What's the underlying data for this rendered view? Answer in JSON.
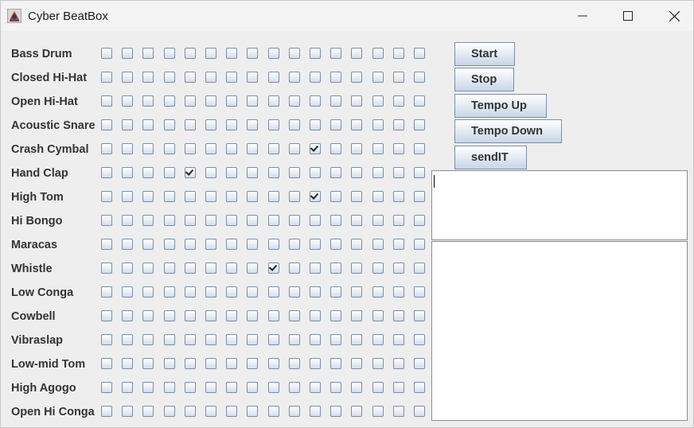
{
  "window": {
    "title": "Cyber BeatBox",
    "controls": [
      "minimize-icon",
      "maximize-icon",
      "close-icon"
    ]
  },
  "instruments": [
    "Bass Drum",
    "Closed Hi-Hat",
    "Open Hi-Hat",
    "Acoustic Snare",
    "Crash Cymbal",
    "Hand Clap",
    "High Tom",
    "Hi Bongo",
    "Maracas",
    "Whistle",
    "Low Conga",
    "Cowbell",
    "Vibraslap",
    "Low-mid Tom",
    "High Agogo",
    "Open Hi Conga"
  ],
  "steps": 16,
  "checked": [
    [
      4,
      10
    ],
    [
      5,
      4
    ],
    [
      6,
      10
    ],
    [
      9,
      8
    ]
  ],
  "buttons": {
    "start": "Start",
    "stop": "Stop",
    "tempo_up": "Tempo Up",
    "tempo_down": "Tempo Down",
    "send": "sendIT"
  },
  "message_input": {
    "value": ""
  },
  "incoming_list": {
    "items": []
  }
}
